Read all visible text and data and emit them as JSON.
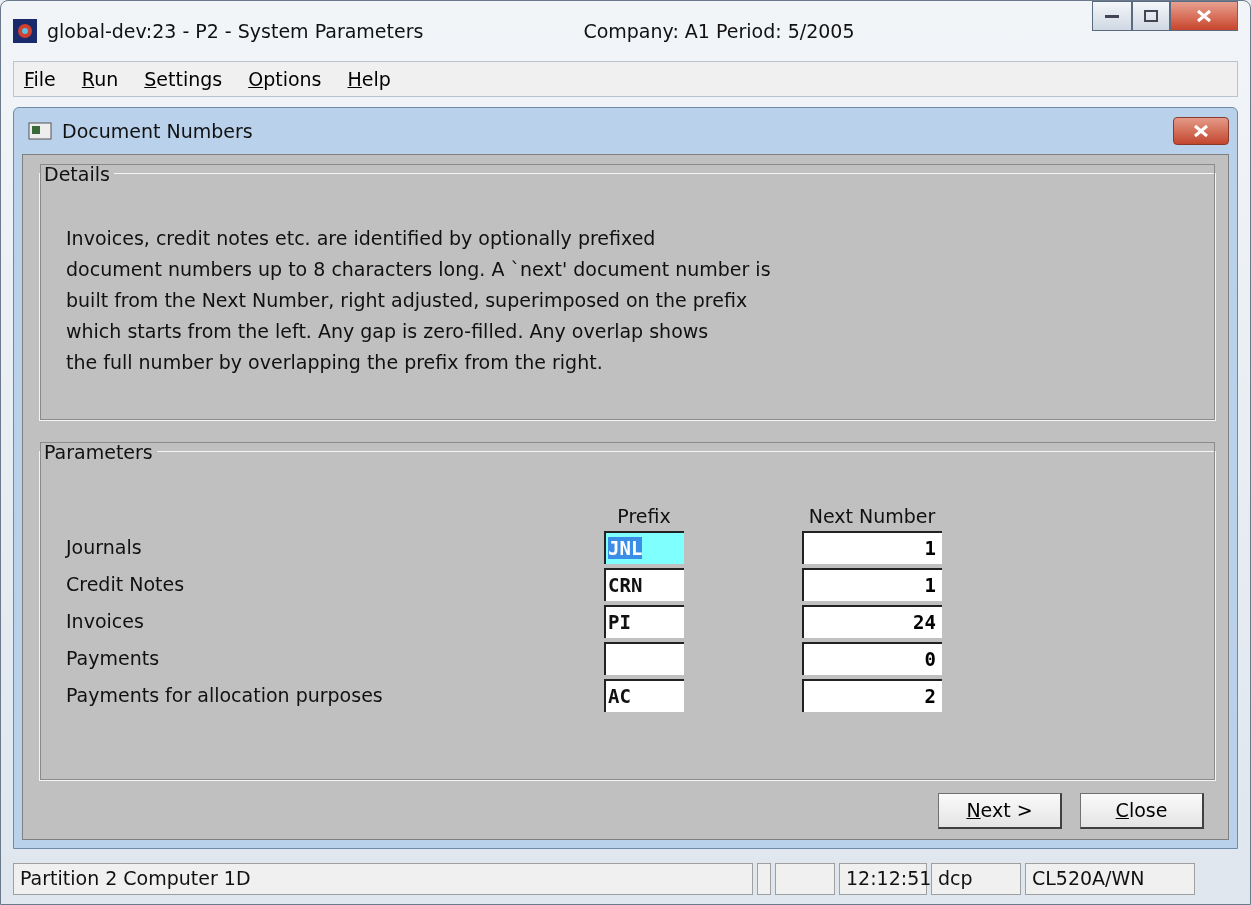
{
  "window": {
    "title": "global-dev:23 - P2 - System Parameters",
    "context": "Company: A1  Period:  5/2005"
  },
  "menu": [
    "File",
    "Run",
    "Settings",
    "Options",
    "Help"
  ],
  "dialog": {
    "title": "Document Numbers",
    "details": {
      "heading": "Details",
      "lines": [
        "Invoices, credit notes etc. are identified by optionally prefixed",
        "document numbers up to 8 characters long.  A `next' document number is",
        "built from the Next Number, right adjusted, superimposed on the prefix",
        "which starts from the left.  Any gap is zero-filled.  Any overlap shows",
        "the full number by overlapping the prefix from the right."
      ]
    },
    "parameters": {
      "heading": "Parameters",
      "columns": [
        "Prefix",
        "Next Number"
      ],
      "rows": [
        {
          "label": "Journals",
          "prefix": "JNL",
          "selected": true,
          "next": "1"
        },
        {
          "label": "Credit Notes",
          "prefix": "CRN",
          "selected": false,
          "next": "1"
        },
        {
          "label": "Invoices",
          "prefix": "PI",
          "selected": false,
          "next": "24"
        },
        {
          "label": "Payments",
          "prefix": "",
          "selected": false,
          "next": "0"
        },
        {
          "label": "Payments for allocation purposes",
          "prefix": "AC",
          "selected": false,
          "next": "2"
        }
      ]
    },
    "buttons": [
      "Next >",
      "Close"
    ]
  },
  "status_bar": {
    "message": "Partition 2 Computer 1D",
    "time": "12:12:51",
    "user": "dcp",
    "code": "CL520A/WN"
  }
}
